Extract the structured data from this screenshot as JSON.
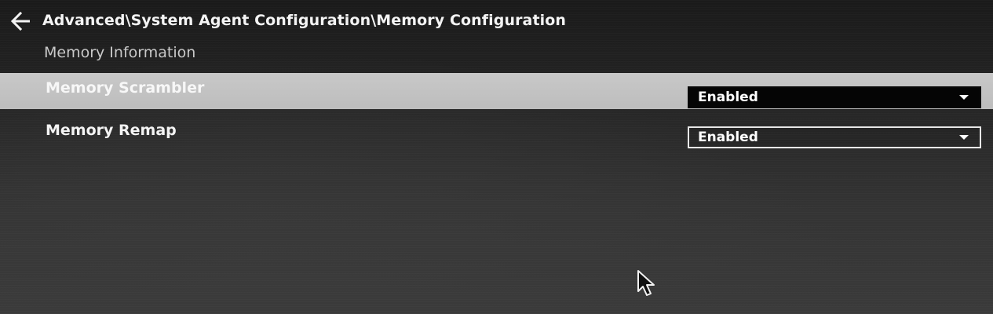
{
  "header": {
    "breadcrumb": "Advanced\\System Agent Configuration\\Memory Configuration",
    "back_icon": "arrow-left-icon"
  },
  "section": {
    "label": "Memory Information"
  },
  "settings": [
    {
      "label": "Memory Scrambler",
      "value": "Enabled",
      "selected": true
    },
    {
      "label": "Memory Remap",
      "value": "Enabled",
      "selected": false
    }
  ],
  "colors": {
    "highlight_row": "#c4c4c4",
    "selected_dropdown_bg": "#050505",
    "dropdown_border": "#e8e8e8",
    "text": "#ffffff",
    "background": "#2a2a2a"
  },
  "pointer_icon": "mouse-pointer-icon"
}
